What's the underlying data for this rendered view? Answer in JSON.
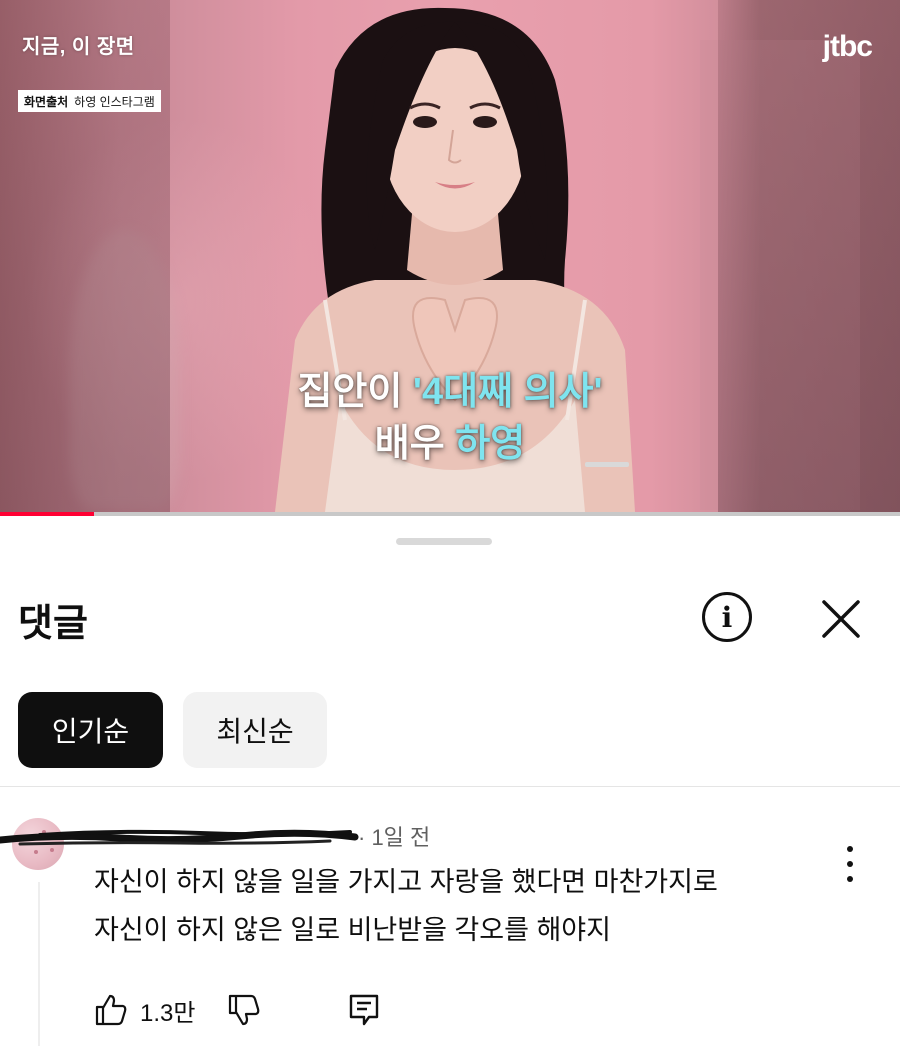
{
  "video": {
    "top_left_title": "지금, 이 장면",
    "source_label": "화면출처",
    "source_value": "하영 인스타그램",
    "channel_logo": "jtbc",
    "caption_line1_prefix": "집안이 ",
    "caption_line1_highlight": "'4대째 의사'",
    "caption_line2_prefix": "배우 ",
    "caption_line2_highlight": "하영",
    "highlight_color": "#7fe4ef",
    "progress_color": "#ff0033"
  },
  "comments_panel": {
    "title": "댓글",
    "info_icon": "info-icon",
    "close_icon": "close-icon",
    "sort_tabs": [
      {
        "label": "인기순",
        "selected": true
      },
      {
        "label": "최신순",
        "selected": false
      }
    ]
  },
  "comment": {
    "author": "",
    "time": "· 1일 전",
    "text_line1": "자신이 하지 않을 일을 가지고 자랑을 했다면 마찬가지로",
    "text_line2": "자신이 하지 않은 일로 비난받을 각오를 해야지",
    "likes": "1.3만",
    "like_icon": "thumbs-up-icon",
    "dislike_icon": "thumbs-down-icon",
    "reply_icon": "reply-icon",
    "menu_icon": "more-vert-icon"
  }
}
